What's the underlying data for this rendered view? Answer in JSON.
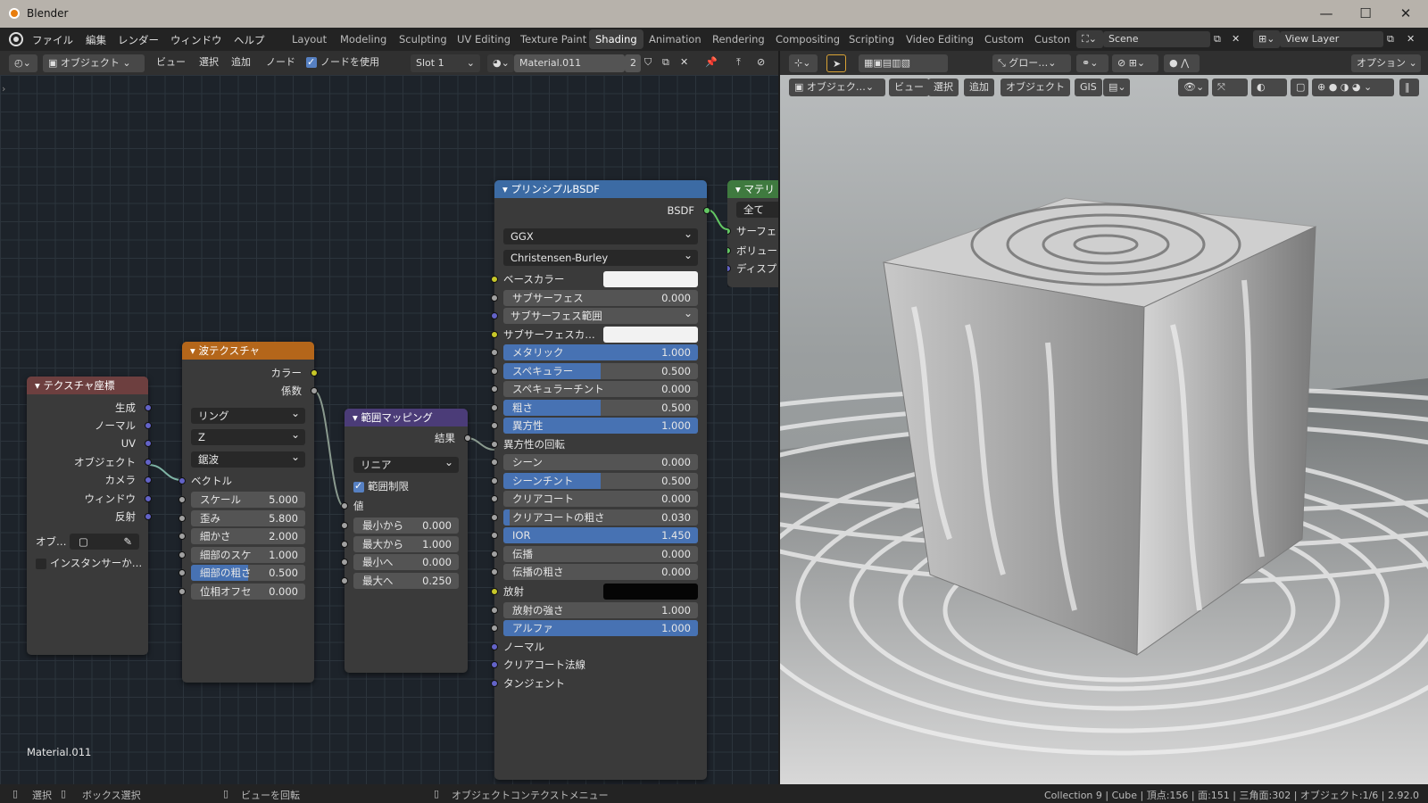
{
  "window": {
    "title": "Blender"
  },
  "menubar": {
    "menus": [
      "ファイル",
      "編集",
      "レンダー",
      "ウィンドウ",
      "ヘルプ"
    ],
    "workspaces": [
      "Layout",
      "Modeling",
      "Sculpting",
      "UV Editing",
      "Texture Paint",
      "Shading",
      "Animation",
      "Rendering",
      "Compositing",
      "Scripting",
      "Video Editing",
      "Custom",
      "Custon"
    ],
    "active_workspace": "Shading",
    "scene": "Scene",
    "view_layer": "View Layer"
  },
  "node_header": {
    "mode": "オブジェクト",
    "menus": [
      "ビュー",
      "選択",
      "追加",
      "ノード"
    ],
    "use_nodes_label": "ノードを使用",
    "use_nodes": true,
    "slot": "Slot 1",
    "material": "Material.011",
    "material_users": "2"
  },
  "viewport_header": {
    "transform": "グロー…",
    "mode": "オブジェク…",
    "menus": [
      "ビュー",
      "選択",
      "追加",
      "オブジェクト",
      "GIS"
    ],
    "options_label": "オプション"
  },
  "nodes": {
    "texcoord": {
      "title": "テクスチャ座標",
      "outputs": [
        "生成",
        "ノーマル",
        "UV",
        "オブジェクト",
        "カメラ",
        "ウィンドウ",
        "反射"
      ],
      "object_label": "オブ…",
      "instancer_label": "インスタンサーか…"
    },
    "wave": {
      "title": "波テクスチャ",
      "outputs": [
        "カラー",
        "係数"
      ],
      "type": "リング",
      "direction": "Z",
      "profile": "鋸波",
      "vector_label": "ベクトル",
      "fields": [
        {
          "label": "スケール",
          "value": "5.000",
          "fill": 0
        },
        {
          "label": "歪み",
          "value": "5.800",
          "fill": 0
        },
        {
          "label": "細かさ",
          "value": "2.000",
          "fill": 0
        },
        {
          "label": "細部のスケ",
          "value": "1.000",
          "fill": 0
        },
        {
          "label": "細部の粗さ",
          "value": "0.500",
          "fill": 0.5
        },
        {
          "label": "位相オフセ",
          "value": "0.000",
          "fill": 0
        }
      ]
    },
    "maprange": {
      "title": "範囲マッピング",
      "output": "結果",
      "interpolation": "リニア",
      "clamp_label": "範囲制限",
      "clamp": true,
      "value_label": "値",
      "fields": [
        {
          "label": "最小から",
          "value": "0.000"
        },
        {
          "label": "最大から",
          "value": "1.000"
        },
        {
          "label": "最小へ",
          "value": "0.000"
        },
        {
          "label": "最大へ",
          "value": "0.250"
        }
      ]
    },
    "bsdf": {
      "title": "プリンシプルBSDF",
      "output": "BSDF",
      "distribution": "GGX",
      "subsurface_method": "Christensen-Burley",
      "base_color_label": "ベースカラー",
      "subsurface_range_label": "サブサーフェス範囲",
      "subsurface_color_label": "サブサーフェスカ…",
      "aniso_rotation_label": "異方性の回転",
      "emission_label": "放射",
      "fields": [
        {
          "key": "subsurface",
          "label": "サブサーフェス",
          "value": "0.000",
          "fill": 0
        },
        {
          "key": "metallic",
          "label": "メタリック",
          "value": "1.000",
          "fill": 1
        },
        {
          "key": "specular",
          "label": "スペキュラー",
          "value": "0.500",
          "fill": 0.5
        },
        {
          "key": "spec_tint",
          "label": "スペキュラーチント",
          "value": "0.000",
          "fill": 0
        },
        {
          "key": "roughness",
          "label": "粗さ",
          "value": "0.500",
          "fill": 0.5
        },
        {
          "key": "anisotropic",
          "label": "異方性",
          "value": "1.000",
          "fill": 1
        },
        {
          "key": "sheen",
          "label": "シーン",
          "value": "0.000",
          "fill": 0
        },
        {
          "key": "sheen_tint",
          "label": "シーンチント",
          "value": "0.500",
          "fill": 0.5
        },
        {
          "key": "clearcoat",
          "label": "クリアコート",
          "value": "0.000",
          "fill": 0
        },
        {
          "key": "clearcoat_rough",
          "label": "クリアコートの粗さ",
          "value": "0.030",
          "fill": 0.03
        },
        {
          "key": "ior",
          "label": "IOR",
          "value": "1.450",
          "fill": 1
        },
        {
          "key": "transmission",
          "label": "伝播",
          "value": "0.000",
          "fill": 0
        },
        {
          "key": "transmission_rough",
          "label": "伝播の粗さ",
          "value": "0.000",
          "fill": 0
        },
        {
          "key": "emission_strength",
          "label": "放射の強さ",
          "value": "1.000",
          "fill": 0
        },
        {
          "key": "alpha",
          "label": "アルファ",
          "value": "1.000",
          "fill": 1
        }
      ],
      "vector_inputs": [
        "ノーマル",
        "クリアコート法線",
        "タンジェント"
      ]
    },
    "output": {
      "title": "マテリ",
      "target": "全て",
      "inputs": [
        "サーフェ",
        "ボリュー",
        "ディスプ"
      ]
    }
  },
  "material_label": "Material.011",
  "statusbar": {
    "select": "選択",
    "box_select": "ボックス選択",
    "rotate_view": "ビューを回転",
    "context_menu": "オブジェクトコンテクストメニュー",
    "stats": "Collection 9 | Cube | 頂点:156 | 面:151 | 三角面:302 | オブジェクト:1/6 | 2.92.0"
  },
  "colors": {
    "accent": "#4772b3",
    "shader_header": "#3c6ba4",
    "texture_header": "#b4661a",
    "converter_header": "#4b3c78",
    "output_header": "#3f7a3f"
  }
}
